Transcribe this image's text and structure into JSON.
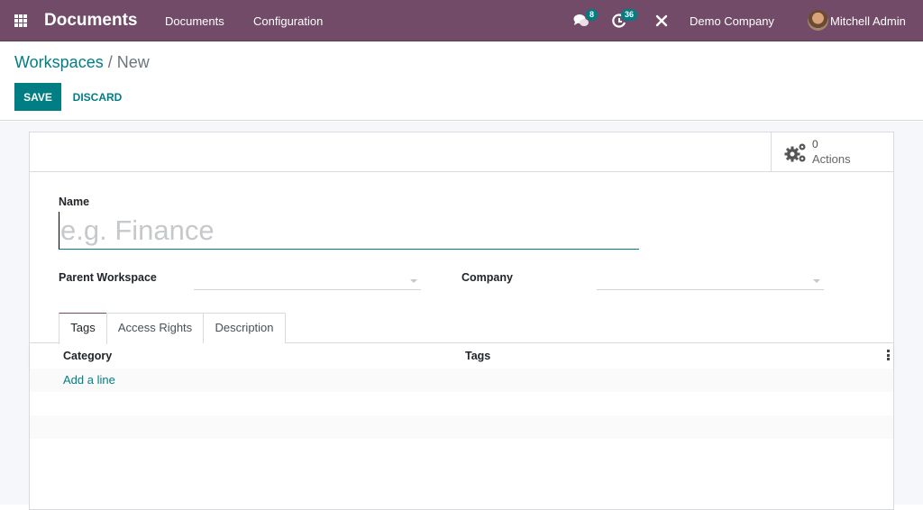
{
  "navbar": {
    "app_icon": "apps-grid-icon",
    "brand": "Documents",
    "menu": [
      "Documents",
      "Configuration"
    ],
    "messages_badge": "8",
    "activities_badge": "36",
    "company": "Demo Company",
    "user": "Mitchell Admin"
  },
  "breadcrumb": {
    "parent": "Workspaces",
    "separator": " / ",
    "current": "New"
  },
  "toolbar": {
    "save_label": "SAVE",
    "discard_label": "DISCARD"
  },
  "stat_button": {
    "icon": "gears-icon",
    "value": "0",
    "label": "Actions"
  },
  "form": {
    "name_label": "Name",
    "name_value": "",
    "name_placeholder": "e.g. Finance",
    "parent_label": "Parent Workspace",
    "parent_value": "",
    "company_label": "Company",
    "company_value": ""
  },
  "tabs": [
    {
      "label": "Tags",
      "active": true
    },
    {
      "label": "Access Rights",
      "active": false
    },
    {
      "label": "Description",
      "active": false
    }
  ],
  "list": {
    "columns": [
      "Category",
      "Tags"
    ],
    "add_line": "Add a line",
    "rows": []
  },
  "colors": {
    "navbar": "#714b67",
    "primary": "#017e84"
  }
}
